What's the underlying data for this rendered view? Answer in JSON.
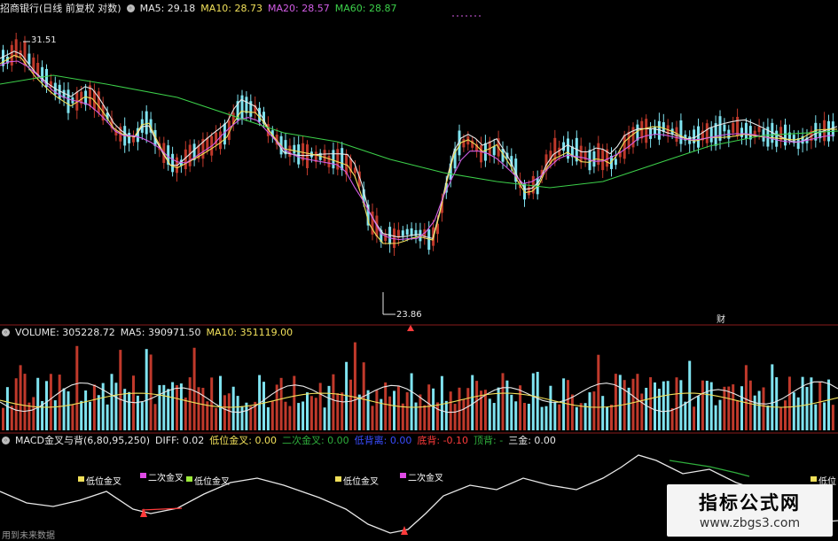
{
  "price_header": {
    "stock": "招商银行(日线 前复权 对数)",
    "ma5": "MA5: 29.18",
    "ma10": "MA10: 28.73",
    "ma20": "MA20: 28.57",
    "ma60": "MA60: 28.87"
  },
  "price_labels": {
    "high": "31.51",
    "low": "23.86",
    "event": "财"
  },
  "volume_header": {
    "title": "VOLUME: 305228.72",
    "ma5": "MA5: 390971.50",
    "ma10": "MA10: 351119.00"
  },
  "macd_header": {
    "title": "MACD金叉与背(6,80,95,250)",
    "diff": "DIFF: 0.02",
    "low_cross": "低位金叉: 0.00",
    "second_cross": "二次金叉: 0.00",
    "trough": "低背离: 0.00",
    "bottom_div": "底背: -0.10",
    "top_div": "顶背: -",
    "three": "三金: 0.00"
  },
  "signals": [
    "低位金叉",
    "二次金叉",
    "低位金叉",
    "低位金叉",
    "二次金叉",
    "低位"
  ],
  "future_text": "用到未来数据",
  "watermark": {
    "cn": "指标公式网",
    "url": "www.zbgs3.com"
  },
  "colors": {
    "up": "#c0392b",
    "down": "#7fe3f0",
    "ma5": "#e8e8e8",
    "ma10": "#f1e05a",
    "ma20": "#d35de6",
    "ma60": "#3cd04a"
  }
}
